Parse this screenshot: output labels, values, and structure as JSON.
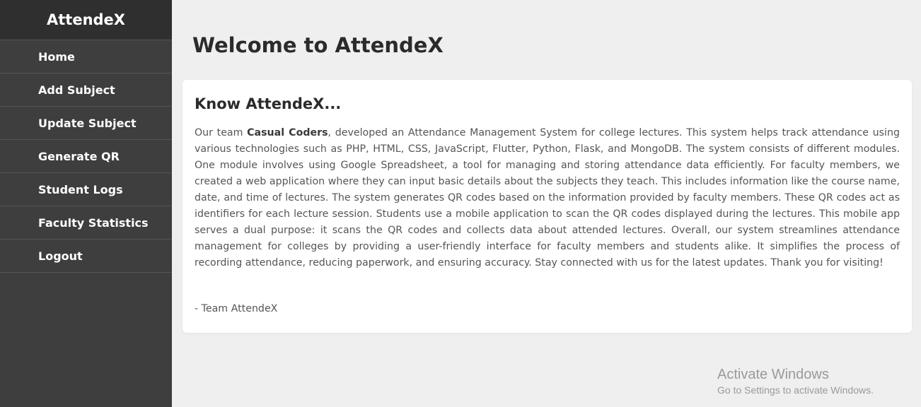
{
  "sidebar": {
    "brand": "AttendeX",
    "items": [
      {
        "label": "Home"
      },
      {
        "label": "Add Subject"
      },
      {
        "label": "Update Subject"
      },
      {
        "label": "Generate QR"
      },
      {
        "label": "Student Logs"
      },
      {
        "label": "Faculty Statistics"
      },
      {
        "label": "Logout"
      }
    ]
  },
  "main": {
    "title": "Welcome to AttendeX",
    "card": {
      "heading": "Know AttendeX...",
      "body_prefix": "Our team ",
      "body_team": "Casual Coders",
      "body_rest": ", developed an Attendance Management System for college lectures. This system helps track attendance using various technologies such as PHP, HTML, CSS, JavaScript, Flutter, Python, Flask, and MongoDB. The system consists of different modules. One module involves using Google Spreadsheet, a tool for managing and storing attendance data efficiently. For faculty members, we created a web application where they can input basic details about the subjects they teach. This includes information like the course name, date, and time of lectures. The system generates QR codes based on the information provided by faculty members. These QR codes act as identifiers for each lecture session. Students use a mobile application to scan the QR codes displayed during the lectures. This mobile app serves a dual purpose: it scans the QR codes and collects data about attended lectures. Overall, our system streamlines attendance management for colleges by providing a user-friendly interface for faculty members and students alike. It simplifies the process of recording attendance, reducing paperwork, and ensuring accuracy. Stay connected with us for the latest updates. Thank you for visiting!",
      "signature": "- Team AttendeX"
    }
  },
  "watermark": {
    "title": "Activate Windows",
    "subtitle": "Go to Settings to activate Windows."
  },
  "colors": {
    "sidebar_bg": "#3e3e3e",
    "brand_bg": "#2f2f2f",
    "page_bg": "#efefef",
    "card_bg": "#ffffff"
  }
}
